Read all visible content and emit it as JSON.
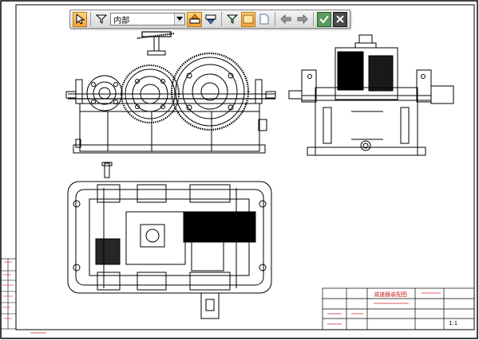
{
  "toolbar": {
    "filter_combo": {
      "selected": "内部"
    }
  },
  "title_block": {
    "scale_label": "1:1",
    "drawing_label": "减速器装配图"
  },
  "colors": {
    "accent_orange": "#f2a53a",
    "ok_green": "#3c8a3c",
    "stamp_red": "#cc2222"
  },
  "icons": [
    "select-arrow-icon",
    "filter-icon",
    "dropdown-arrow-icon",
    "layer-up-icon",
    "layer-down-icon",
    "check-filter-icon",
    "rectangle-select-icon",
    "page-icon",
    "arrow-left-icon",
    "arrow-right-icon",
    "confirm-icon",
    "close-icon"
  ]
}
